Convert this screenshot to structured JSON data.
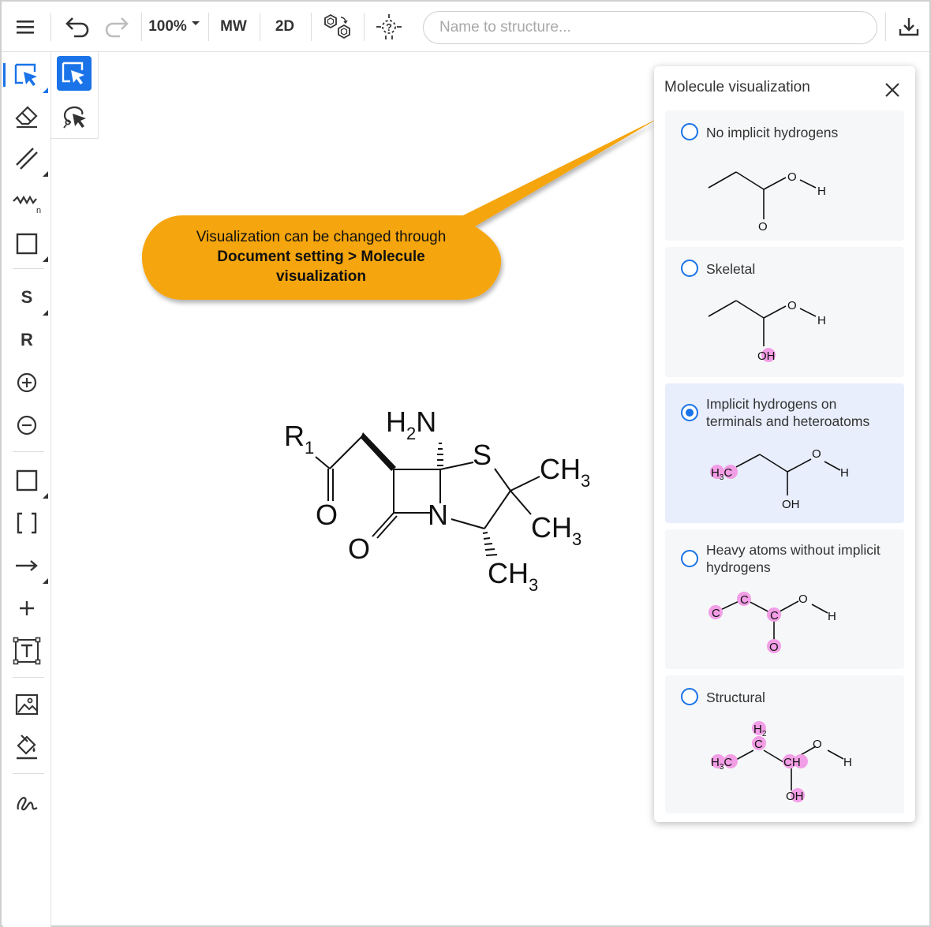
{
  "toolbar": {
    "zoom": "100%",
    "mw_label": "MW",
    "dim_label": "2D",
    "search_placeholder": "Name to structure..."
  },
  "sidebar": {
    "tool_s": "S",
    "tool_r": "R"
  },
  "callout": {
    "line1": "Visualization can be changed through",
    "line2": "Document setting > Molecule",
    "line3": "visualization"
  },
  "molecule": {
    "r_label": "R",
    "r_sub": "1",
    "o1": "O",
    "o2": "O",
    "n": "N",
    "s": "S",
    "h2n_h": "H",
    "h2n_sub": "2",
    "h2n_n": "N",
    "ch3_c": "CH",
    "ch3_sub": "3"
  },
  "panel": {
    "title": "Molecule visualization",
    "options": [
      {
        "label": "No implicit hydrogens",
        "selected": false
      },
      {
        "label": "Skeletal",
        "selected": false
      },
      {
        "label": "Implicit hydrogens on terminals and heteroatoms",
        "selected": true
      },
      {
        "label": "Heavy atoms without implicit hydrogens",
        "selected": false
      },
      {
        "label": "Structural",
        "selected": false
      }
    ],
    "atoms": {
      "o": "O",
      "h": "H",
      "oh": "OH",
      "h3c_h": "H",
      "h3c_sub": "3",
      "h3c_c": "C",
      "c": "C",
      "ch": "CH",
      "h2_h": "H",
      "h2_sub": "2"
    }
  },
  "colors": {
    "accent": "#1a73e8",
    "callout": "#f5a50a",
    "highlight": "#f29ee6"
  }
}
